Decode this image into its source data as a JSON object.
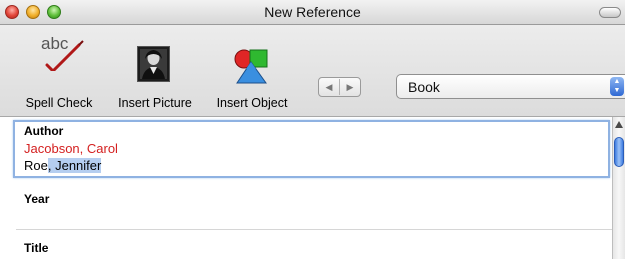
{
  "window": {
    "title": "New Reference"
  },
  "toolbar": {
    "spell_check": {
      "label": "Spell Check",
      "icon_text": "abc",
      "icon": "spell-check-icon"
    },
    "insert_picture": {
      "label": "Insert Picture",
      "icon": "portrait-picture-icon"
    },
    "insert_object": {
      "label": "Insert Object",
      "icon": "shapes-object-icon"
    },
    "nav": {
      "prev_glyph": "◀",
      "next_glyph": "▶"
    },
    "reference_type": {
      "selected": "Book",
      "arrows": "▲▼"
    }
  },
  "fields": {
    "author": {
      "label": "Author",
      "lines": [
        {
          "text": "Jacobson, Carol",
          "color": "#d42020"
        },
        {
          "text_before": "Roe",
          "text_selected": ", Jennifer"
        }
      ]
    },
    "year": {
      "label": "Year",
      "value": ""
    },
    "title": {
      "label": "Title",
      "value": ""
    }
  },
  "colors": {
    "selection": "#b5cef0",
    "focus_ring": "#8fb2e2",
    "error_text": "#d42020",
    "scroll_thumb": "#3d7be0"
  }
}
